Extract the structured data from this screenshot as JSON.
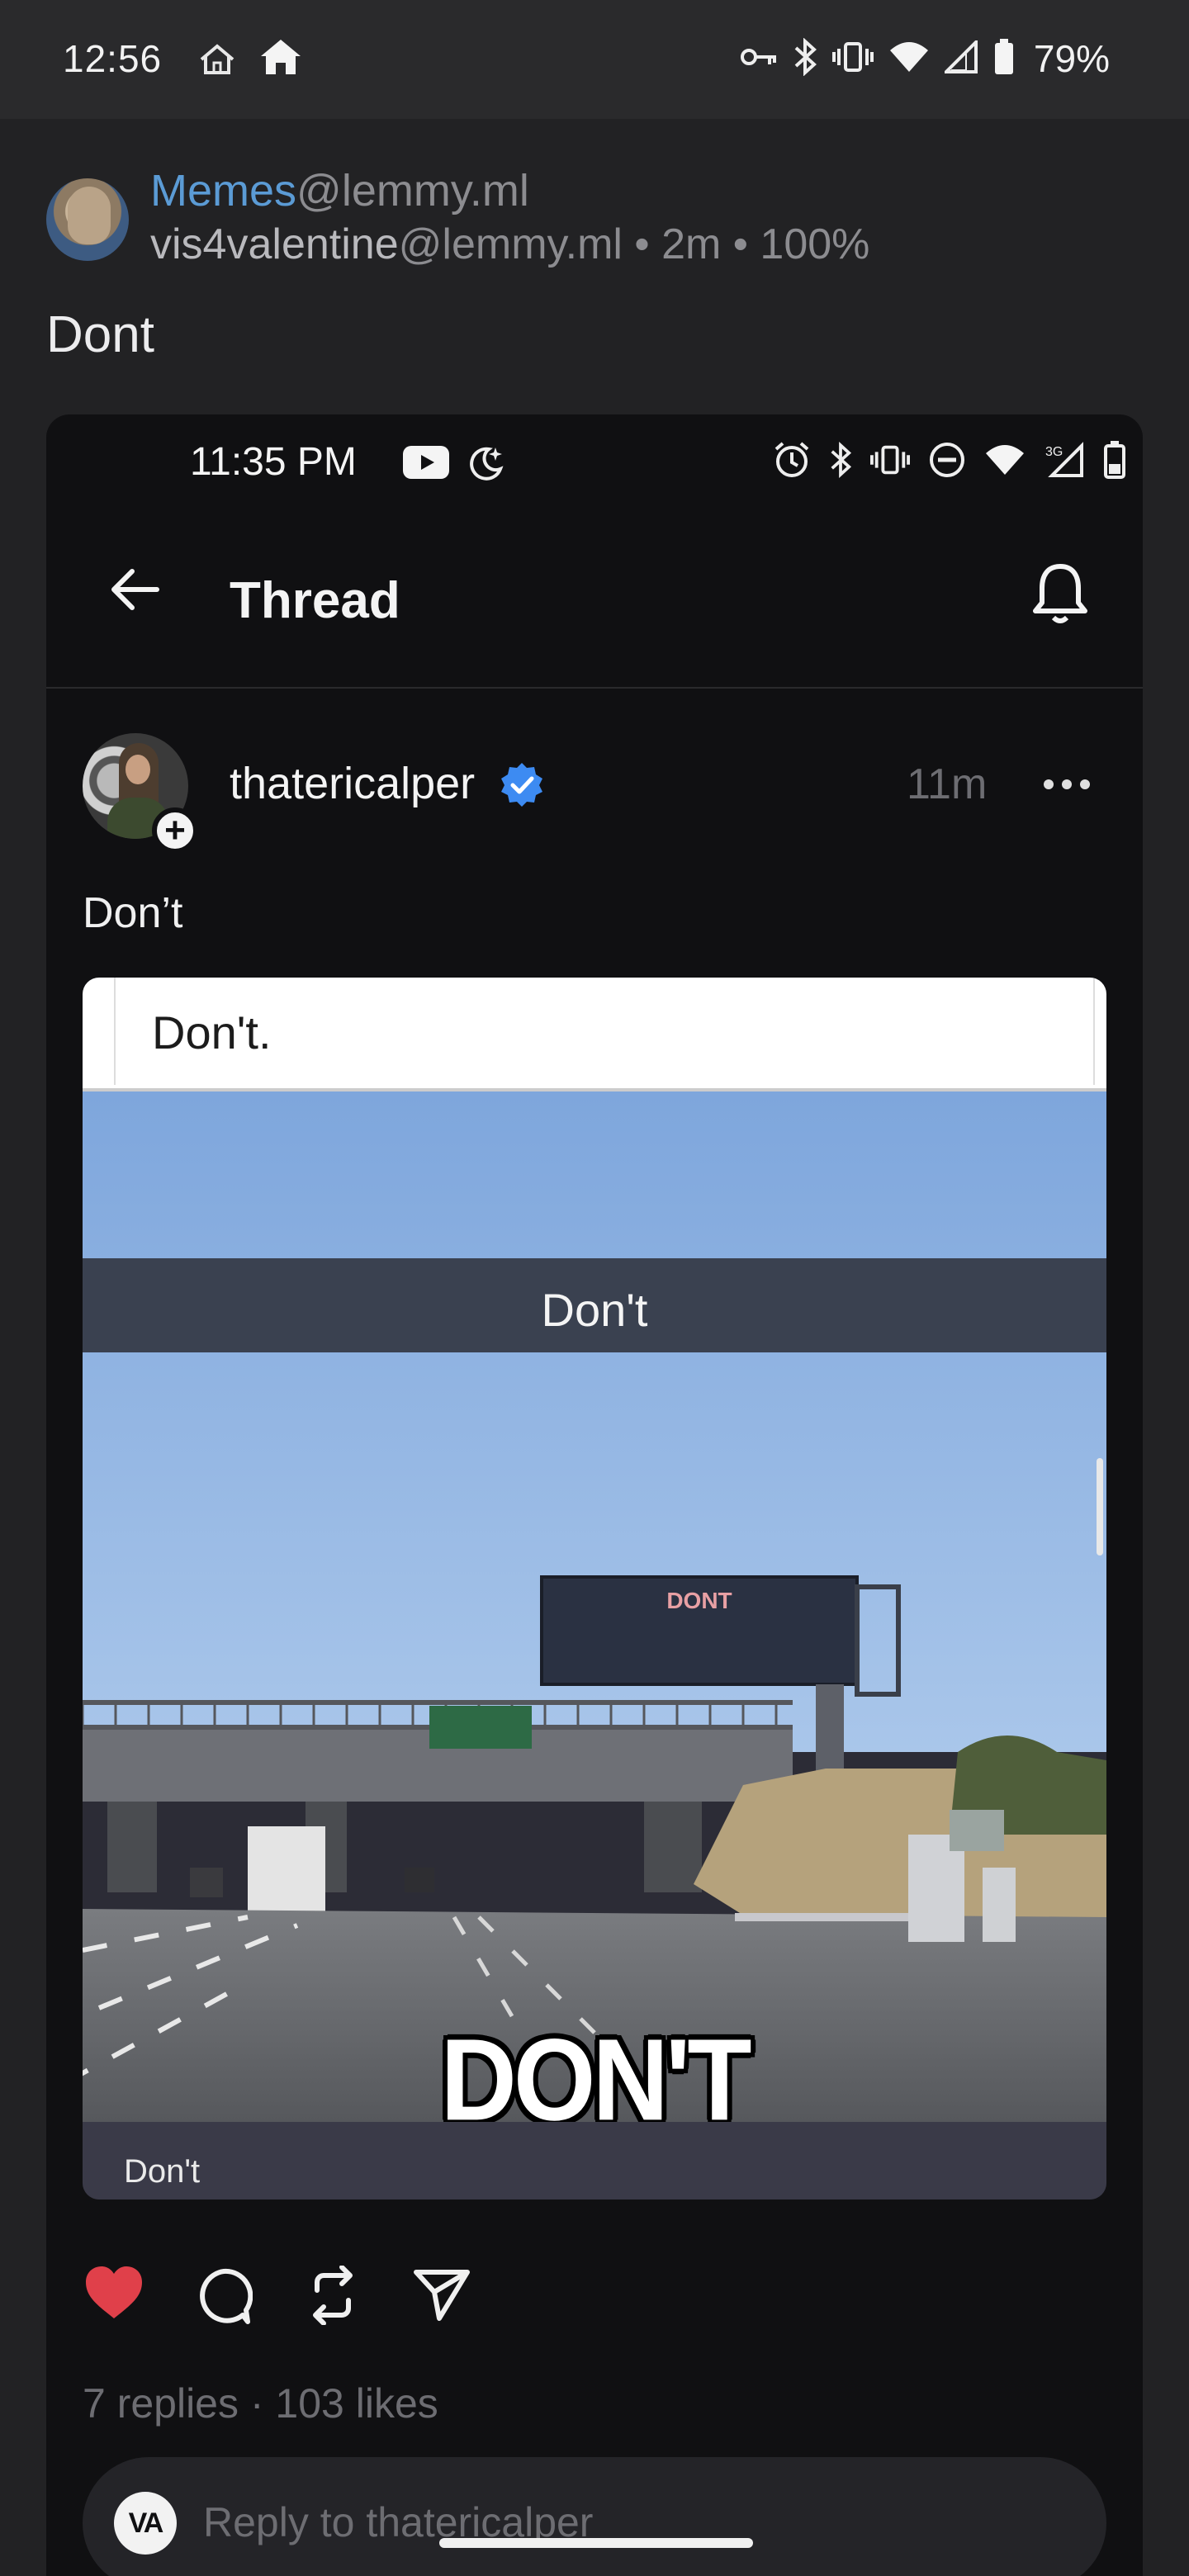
{
  "status_bar": {
    "time": "12:56",
    "battery": "79%",
    "icons": [
      "home-outline-icon",
      "home-filled-icon",
      "vpn-key-icon",
      "bluetooth-icon",
      "vibrate-icon",
      "wifi-icon",
      "signal-icon",
      "battery-icon"
    ]
  },
  "post": {
    "community_name": "Memes",
    "community_instance": "@lemmy.ml",
    "author_name": "vis4valentine",
    "author_instance": "@lemmy.ml",
    "meta": " • 2m • 100%",
    "title": "Dont"
  },
  "embedded": {
    "status_bar": {
      "time": "11:35 PM",
      "icons": [
        "youtube-icon",
        "moon-icon",
        "alarm-icon",
        "bluetooth-icon",
        "vibrate-icon",
        "dnd-icon",
        "wifi-icon",
        "signal-3g-icon",
        "battery-icon"
      ]
    },
    "header": {
      "title": "Thread"
    },
    "thread": {
      "username": "thatericalper",
      "time": "11m",
      "text": "Don’t"
    },
    "meme": {
      "top_text": "Don't.",
      "band_text": "Don't",
      "sign_text": "DONT",
      "big_text": "DON'T",
      "caption": "Don't"
    },
    "counts": "7 replies · 103 likes",
    "reply": {
      "avatar_text": "VA",
      "placeholder": "Reply to thatericalper"
    },
    "colors": {
      "like": "#e0404a",
      "verified": "#3d8bf2",
      "link": "#5b9bd5"
    }
  }
}
